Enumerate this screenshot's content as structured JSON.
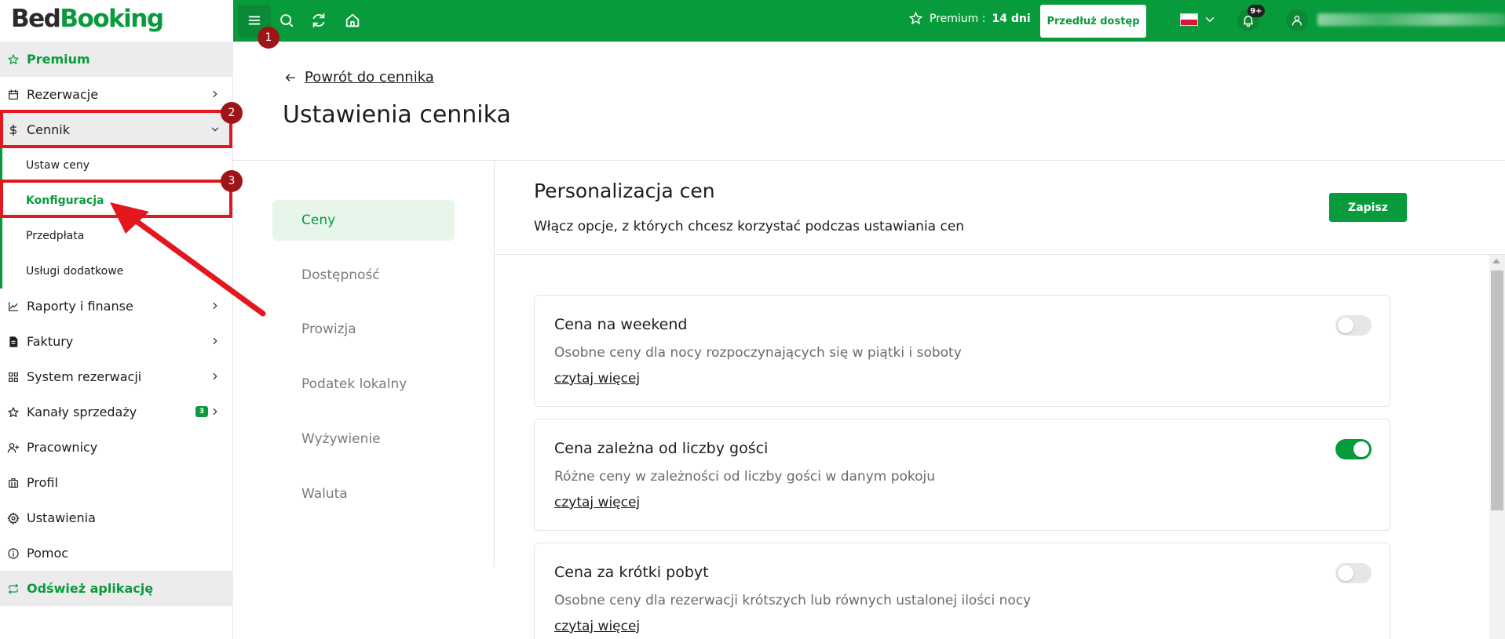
{
  "app": {
    "logo_part1": "Bed",
    "logo_part2": "Booking"
  },
  "topbar": {
    "premium_label": "Premium :",
    "premium_days": "14 dni",
    "extend_button": "Przedłuż dostęp",
    "notifications_count": "9+",
    "language": "pl"
  },
  "sidebar": {
    "premium": "Premium",
    "reservations": "Rezerwacje",
    "pricing": "Cennik",
    "pricing_sub": [
      "Ustaw ceny",
      "Konfiguracja",
      "Przedpłata",
      "Usługi dodatkowe"
    ],
    "reports": "Raporty i finanse",
    "invoices": "Faktury",
    "booking_system": "System rezerwacji",
    "sales_channels": "Kanały sprzedaży",
    "sales_channels_badge": "3",
    "employees": "Pracownicy",
    "profile": "Profil",
    "settings": "Ustawienia",
    "help": "Pomoc",
    "refresh": "Odśwież aplikację"
  },
  "annotations": {
    "step1": "1",
    "step2": "2",
    "step3": "3"
  },
  "main": {
    "back_link": "Powrót do cennika",
    "page_title": "Ustawienia cennika",
    "nav": [
      "Ceny",
      "Dostępność",
      "Prowizja",
      "Podatek lokalny",
      "Wyżywienie",
      "Waluta"
    ],
    "active_nav": "Ceny",
    "section_title": "Personalizacja cen",
    "section_subtitle": "Włącz opcje, z których chcesz korzystać podczas ustawiania cen",
    "save_button": "Zapisz",
    "cards": [
      {
        "title": "Cena na weekend",
        "description": "Osobne ceny dla nocy rozpoczynających się w piątki i soboty",
        "link": "czytaj więcej",
        "enabled": false
      },
      {
        "title": "Cena zależna od liczby gości",
        "description": "Różne ceny w zależności od liczby gości w danym pokoju",
        "link": "czytaj więcej",
        "enabled": true
      },
      {
        "title": "Cena za krótki pobyt",
        "description": "Osobne ceny dla rezerwacji krótszych lub równych ustalonej ilości nocy",
        "link": "czytaj więcej",
        "enabled": false
      }
    ]
  },
  "colors": {
    "brand_green": "#089b3b",
    "annotation_red": "#e3171e",
    "step_badge": "#9d1518"
  }
}
